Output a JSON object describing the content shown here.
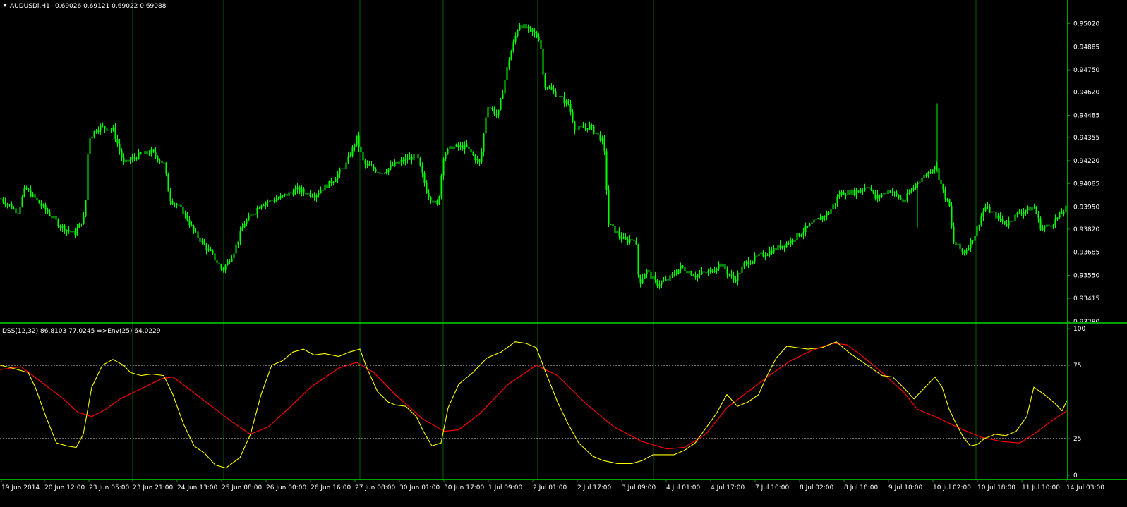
{
  "colors": {
    "background": "#000000",
    "frame": "#00a000",
    "grid": "#006400",
    "candles": "#00ff00",
    "axis_text": "#ffffff",
    "header_text": "#ffffff",
    "dss_line": "#ffff00",
    "env_line": "#ff0000",
    "level_line": "#ffffff"
  },
  "header": {
    "symbol": "AUDUSDi,H1",
    "ohlc": "0.69026 0.69121 0.69022 0.69088"
  },
  "indicator_header": {
    "text": "DSS(12,32) 86.8103 77.0245  =>Env(25) 64.0229"
  },
  "chart_data": [
    {
      "type": "candlestick",
      "name": "price",
      "ylim": [
        0.9328,
        0.9515
      ],
      "y_ticks": [
        "0.95020",
        "0.94885",
        "0.94750",
        "0.94620",
        "0.94485",
        "0.94355",
        "0.94220",
        "0.94085",
        "0.93950",
        "0.93820",
        "0.93685",
        "0.93550",
        "0.93415",
        "0.93280"
      ],
      "x_tick_labels": [
        "19 Jun 2014",
        "20 Jun 12:00",
        "23 Jun 05:00",
        "23 Jun 21:00",
        "24 Jun 13:00",
        "25 Jun 08:00",
        "26 Jun 00:00",
        "26 Jun 16:00",
        "27 Jun 08:00",
        "30 Jun 01:00",
        "30 Jun 17:00",
        "1 Jul 09:00",
        "2 Jul 01:00",
        "2 Jul 17:00",
        "3 Jul 09:00",
        "4 Jul 01:00",
        "4 Jul 17:00",
        "7 Jul 10:00",
        "8 Jul 02:00",
        "8 Jul 18:00",
        "9 Jul 10:00",
        "10 Jul 02:00",
        "10 Jul 18:00",
        "11 Jul 10:00",
        "14 Jul 03:00"
      ],
      "close_path": [
        [
          0,
          0.94
        ],
        [
          25,
          0.9392
        ],
        [
          35,
          0.9406
        ],
        [
          60,
          0.9395
        ],
        [
          85,
          0.9384
        ],
        [
          105,
          0.9379
        ],
        [
          120,
          0.939
        ],
        [
          125,
          0.9435
        ],
        [
          140,
          0.9442
        ],
        [
          160,
          0.944
        ],
        [
          175,
          0.942
        ],
        [
          195,
          0.9425
        ],
        [
          215,
          0.9427
        ],
        [
          232,
          0.942
        ],
        [
          240,
          0.94
        ],
        [
          260,
          0.9392
        ],
        [
          275,
          0.938
        ],
        [
          300,
          0.9367
        ],
        [
          315,
          0.9358
        ],
        [
          330,
          0.9368
        ],
        [
          345,
          0.9385
        ],
        [
          370,
          0.9397
        ],
        [
          395,
          0.94
        ],
        [
          420,
          0.9405
        ],
        [
          445,
          0.9402
        ],
        [
          470,
          0.941
        ],
        [
          490,
          0.942
        ],
        [
          505,
          0.9435
        ],
        [
          515,
          0.942
        ],
        [
          540,
          0.9415
        ],
        [
          560,
          0.942
        ],
        [
          590,
          0.9425
        ],
        [
          605,
          0.9403
        ],
        [
          620,
          0.9395
        ],
        [
          628,
          0.9425
        ],
        [
          640,
          0.943
        ],
        [
          660,
          0.943
        ],
        [
          680,
          0.942
        ],
        [
          690,
          0.9455
        ],
        [
          705,
          0.9448
        ],
        [
          720,
          0.948
        ],
        [
          735,
          0.9502
        ],
        [
          750,
          0.9498
        ],
        [
          765,
          0.9493
        ],
        [
          770,
          0.9467
        ],
        [
          790,
          0.946
        ],
        [
          805,
          0.9455
        ],
        [
          815,
          0.944
        ],
        [
          835,
          0.9442
        ],
        [
          855,
          0.9433
        ],
        [
          862,
          0.9385
        ],
        [
          885,
          0.9375
        ],
        [
          900,
          0.9377
        ],
        [
          905,
          0.935
        ],
        [
          915,
          0.9358
        ],
        [
          930,
          0.935
        ],
        [
          945,
          0.9352
        ],
        [
          965,
          0.936
        ],
        [
          985,
          0.9355
        ],
        [
          1005,
          0.9357
        ],
        [
          1020,
          0.9362
        ],
        [
          1040,
          0.9352
        ],
        [
          1055,
          0.9362
        ],
        [
          1075,
          0.9366
        ],
        [
          1095,
          0.937
        ],
        [
          1120,
          0.9375
        ],
        [
          1135,
          0.938
        ],
        [
          1150,
          0.9385
        ],
        [
          1175,
          0.9392
        ],
        [
          1190,
          0.9403
        ],
        [
          1215,
          0.9404
        ],
        [
          1230,
          0.9408
        ],
        [
          1240,
          0.94
        ],
        [
          1260,
          0.9405
        ],
        [
          1280,
          0.9398
        ],
        [
          1300,
          0.941
        ],
        [
          1315,
          0.9415
        ],
        [
          1325,
          0.942
        ],
        [
          1335,
          0.9405
        ],
        [
          1345,
          0.9395
        ],
        [
          1350,
          0.9375
        ],
        [
          1365,
          0.9368
        ],
        [
          1380,
          0.9378
        ],
        [
          1395,
          0.9395
        ],
        [
          1410,
          0.939
        ],
        [
          1425,
          0.9385
        ],
        [
          1445,
          0.9392
        ],
        [
          1465,
          0.9395
        ],
        [
          1475,
          0.9382
        ],
        [
          1490,
          0.9385
        ],
        [
          1512,
          0.9395
        ]
      ]
    },
    {
      "type": "line",
      "name": "indicator",
      "ylim": [
        0,
        100
      ],
      "y_ticks": [
        "100",
        "75",
        "25",
        "0"
      ],
      "levels": [
        75,
        25
      ],
      "series": [
        {
          "name": "DSS",
          "points": [
            [
              0,
              75
            ],
            [
              10,
              74
            ],
            [
              25,
              72
            ],
            [
              40,
              70
            ],
            [
              50,
              60
            ],
            [
              65,
              40
            ],
            [
              80,
              22
            ],
            [
              95,
              20
            ],
            [
              108,
              19
            ],
            [
              118,
              28
            ],
            [
              130,
              60
            ],
            [
              145,
              75
            ],
            [
              160,
              79
            ],
            [
              175,
              75
            ],
            [
              185,
              70
            ],
            [
              200,
              68
            ],
            [
              215,
              69
            ],
            [
              232,
              68
            ],
            [
              245,
              55
            ],
            [
              260,
              35
            ],
            [
              275,
              20
            ],
            [
              290,
              15
            ],
            [
              305,
              7
            ],
            [
              320,
              5
            ],
            [
              340,
              12
            ],
            [
              355,
              28
            ],
            [
              370,
              55
            ],
            [
              385,
              75
            ],
            [
              400,
              78
            ],
            [
              415,
              84
            ],
            [
              430,
              86
            ],
            [
              445,
              82
            ],
            [
              460,
              83
            ],
            [
              480,
              81
            ],
            [
              495,
              84
            ],
            [
              510,
              86
            ],
            [
              520,
              73
            ],
            [
              535,
              57
            ],
            [
              550,
              50
            ],
            [
              560,
              48
            ],
            [
              575,
              47
            ],
            [
              590,
              40
            ],
            [
              600,
              30
            ],
            [
              612,
              20
            ],
            [
              625,
              22
            ],
            [
              635,
              46
            ],
            [
              650,
              62
            ],
            [
              670,
              70
            ],
            [
              690,
              80
            ],
            [
              710,
              84
            ],
            [
              730,
              91
            ],
            [
              745,
              90
            ],
            [
              760,
              87
            ],
            [
              775,
              68
            ],
            [
              790,
              50
            ],
            [
              805,
              35
            ],
            [
              820,
              22
            ],
            [
              840,
              13
            ],
            [
              855,
              10
            ],
            [
              875,
              8
            ],
            [
              895,
              8
            ],
            [
              910,
              10
            ],
            [
              925,
              14
            ],
            [
              940,
              14
            ],
            [
              955,
              14
            ],
            [
              970,
              17
            ],
            [
              985,
              22
            ],
            [
              1000,
              32
            ],
            [
              1015,
              42
            ],
            [
              1030,
              55
            ],
            [
              1045,
              47
            ],
            [
              1060,
              50
            ],
            [
              1075,
              55
            ],
            [
              1085,
              66
            ],
            [
              1100,
              80
            ],
            [
              1115,
              88
            ],
            [
              1130,
              87
            ],
            [
              1145,
              86
            ],
            [
              1165,
              87
            ],
            [
              1185,
              91
            ],
            [
              1205,
              83
            ],
            [
              1220,
              78
            ],
            [
              1235,
              73
            ],
            [
              1250,
              68
            ],
            [
              1265,
              67
            ],
            [
              1280,
              60
            ],
            [
              1295,
              52
            ],
            [
              1305,
              57
            ],
            [
              1315,
              62
            ],
            [
              1325,
              67
            ],
            [
              1335,
              60
            ],
            [
              1345,
              45
            ],
            [
              1355,
              35
            ],
            [
              1365,
              26
            ],
            [
              1375,
              20
            ],
            [
              1385,
              21
            ],
            [
              1395,
              25
            ],
            [
              1410,
              28
            ],
            [
              1425,
              27
            ],
            [
              1440,
              30
            ],
            [
              1455,
              40
            ],
            [
              1465,
              60
            ],
            [
              1480,
              55
            ],
            [
              1495,
              49
            ],
            [
              1505,
              44
            ],
            [
              1512,
              51
            ]
          ]
        },
        {
          "name": "Env",
          "points": [
            [
              0,
              72
            ],
            [
              30,
              74
            ],
            [
              60,
              63
            ],
            [
              90,
              52
            ],
            [
              110,
              43
            ],
            [
              130,
              40
            ],
            [
              150,
              45
            ],
            [
              170,
              52
            ],
            [
              200,
              59
            ],
            [
              230,
              66
            ],
            [
              245,
              67
            ],
            [
              270,
              58
            ],
            [
              300,
              47
            ],
            [
              330,
              36
            ],
            [
              355,
              28
            ],
            [
              380,
              33
            ],
            [
              410,
              46
            ],
            [
              440,
              60
            ],
            [
              480,
              73
            ],
            [
              505,
              77
            ],
            [
              530,
              70
            ],
            [
              560,
              55
            ],
            [
              600,
              38
            ],
            [
              630,
              30
            ],
            [
              650,
              31
            ],
            [
              680,
              42
            ],
            [
              720,
              62
            ],
            [
              760,
              75
            ],
            [
              790,
              68
            ],
            [
              830,
              49
            ],
            [
              870,
              33
            ],
            [
              910,
              23
            ],
            [
              945,
              18
            ],
            [
              970,
              19
            ],
            [
              1000,
              28
            ],
            [
              1030,
              46
            ],
            [
              1060,
              57
            ],
            [
              1090,
              68
            ],
            [
              1120,
              78
            ],
            [
              1150,
              85
            ],
            [
              1180,
              90
            ],
            [
              1200,
              89
            ],
            [
              1220,
              82
            ],
            [
              1250,
              70
            ],
            [
              1280,
              57
            ],
            [
              1300,
              45
            ],
            [
              1330,
              39
            ],
            [
              1360,
              32
            ],
            [
              1390,
              26
            ],
            [
              1420,
              23
            ],
            [
              1445,
              22
            ],
            [
              1465,
              28
            ],
            [
              1490,
              37
            ],
            [
              1512,
              44
            ]
          ]
        }
      ]
    }
  ]
}
